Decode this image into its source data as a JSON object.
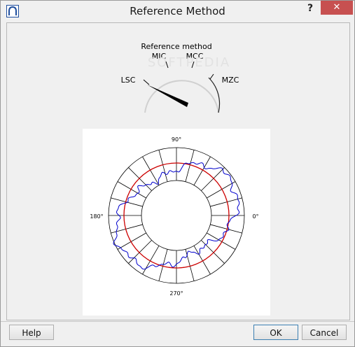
{
  "window": {
    "title": "Reference Method",
    "help_glyph": "?",
    "close_glyph": "✕",
    "app_icon": "measurement-arch-icon"
  },
  "dial": {
    "title": "Reference method",
    "labels": [
      "LSC",
      "MIC",
      "MCC",
      "MZC"
    ],
    "selected": "LSC",
    "pointer_icon": "needle-pointer-icon"
  },
  "plot": {
    "angle_labels": {
      "top": "90°",
      "left": "180°",
      "right": "0°",
      "bottom": "270°"
    },
    "reference_color": "#cc0000",
    "profile_color": "#0000cc",
    "grid_color": "#000000"
  },
  "buttons": {
    "help": "Help",
    "ok": "OK",
    "cancel": "Cancel"
  },
  "watermark": "SOFTPEDIA"
}
